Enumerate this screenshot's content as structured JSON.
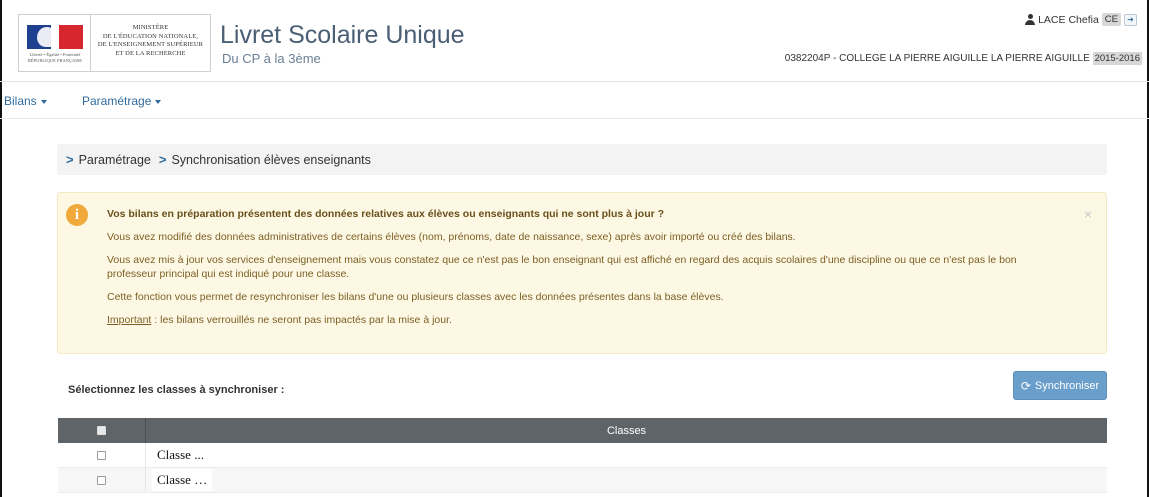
{
  "header": {
    "logo": {
      "ministry_text": "MINISTÈRE\nDE L'ÉDUCATION NATIONALE,\nDE L'ENSEIGNEMENT SUPÉRIEUR\nET DE LA RECHERCHE",
      "motto_text": "Liberté • Égalité • Fraternité\nRÉPUBLIQUE FRANÇAISE"
    },
    "app_title": "Livret Scolaire Unique",
    "app_subtitle": "Du CP à la 3ème",
    "user_name": "LACE Chefia",
    "user_role": "CE",
    "school": "0382204P - COLLEGE LA PIERRE AIGUILLE LA PIERRE AIGUILLE",
    "school_year": "2015-2016"
  },
  "nav": {
    "items": [
      {
        "label": "Bilans"
      },
      {
        "label": "Paramétrage"
      }
    ]
  },
  "breadcrumb": {
    "items": [
      "Paramétrage",
      "Synchronisation élèves enseignants"
    ]
  },
  "alert": {
    "title": "Vos bilans en préparation présentent des données relatives aux élèves ou enseignants qui ne sont plus à jour ?",
    "p1": "Vous avez modifié des données administratives de certains élèves (nom, prénoms, date de naissance, sexe) après avoir importé ou créé des bilans.",
    "p2": "Vous avez mis à jour vos services d'enseignement mais vous constatez que ce n'est pas le bon enseignant qui est affiché en regard des acquis scolaires d'une discipline ou que ce n'est pas le bon professeur principal qui est indiqué pour une classe.",
    "p3": "Cette fonction vous permet de resynchroniser les bilans d'une ou plusieurs classes avec les données présentes dans la base élèves.",
    "important_label": "Important",
    "important_text": " : les bilans verrouillés ne seront pas impactés par la mise à jour.",
    "close": "×"
  },
  "selection": {
    "label": "Sélectionnez les classes à synchroniser :",
    "sync_button": "Synchroniser"
  },
  "table": {
    "header_classes": "Classes",
    "rows": [
      {
        "classe": "Classe ..."
      },
      {
        "classe": "Classe …"
      }
    ]
  },
  "colors": {
    "accent": "#2f6b9c",
    "button": "#6a9ecb",
    "alert_bg": "#fcf8e4",
    "table_header": "#5f6468"
  }
}
